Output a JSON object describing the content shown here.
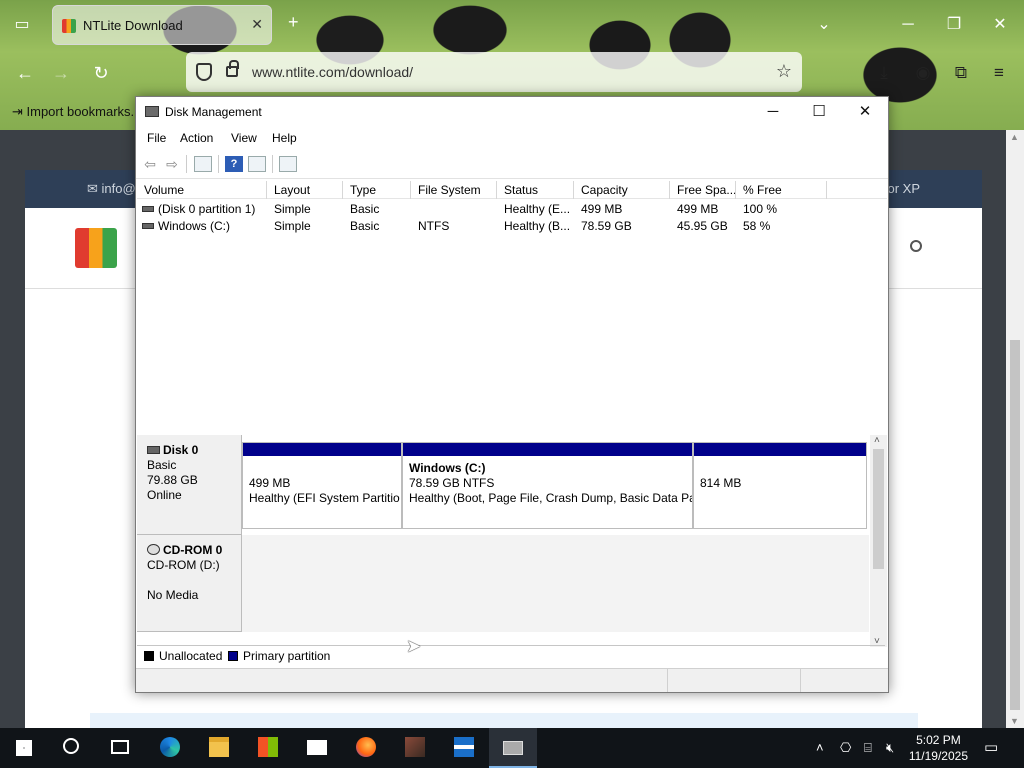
{
  "browser": {
    "tab_title": "NTLite Download",
    "url": "www.ntlite.com/download/",
    "bookmarks_import": "Import bookmarks..."
  },
  "website": {
    "header_left": "info@",
    "header_right": "or XP"
  },
  "disk_management": {
    "title": "Disk Management",
    "menu": [
      "File",
      "Action",
      "View",
      "Help"
    ],
    "columns": [
      "Volume",
      "Layout",
      "Type",
      "File System",
      "Status",
      "Capacity",
      "Free Spa...",
      "% Free"
    ],
    "volumes": [
      [
        "(Disk 0 partition 1)",
        "Simple",
        "Basic",
        "",
        "Healthy (E...",
        "499 MB",
        "499 MB",
        "100 %"
      ],
      [
        "Windows (C:)",
        "Simple",
        "Basic",
        "NTFS",
        "Healthy (B...",
        "78.59 GB",
        "45.95 GB",
        "58 %"
      ]
    ],
    "disks": [
      {
        "name": "Disk 0",
        "lines": [
          "Basic",
          "79.88 GB",
          "Online"
        ],
        "partitions": [
          {
            "title": "",
            "size": "499 MB",
            "status": "Healthy (EFI System Partitio"
          },
          {
            "title": "Windows  (C:)",
            "size": "78.59 GB NTFS",
            "status": "Healthy (Boot, Page File, Crash Dump, Basic Data Pa"
          },
          {
            "title": "",
            "size": "814 MB",
            "status": ""
          }
        ]
      },
      {
        "name": "CD-ROM 0",
        "lines": [
          "CD-ROM (D:)",
          "",
          "No Media"
        ]
      }
    ],
    "legend": {
      "unallocated": "Unallocated",
      "primary": "Primary partition",
      "unallocated_color": "#000000",
      "primary_color": "#00008b"
    }
  },
  "taskbar": {
    "time": "5:02 PM",
    "date": "11/19/2025"
  }
}
